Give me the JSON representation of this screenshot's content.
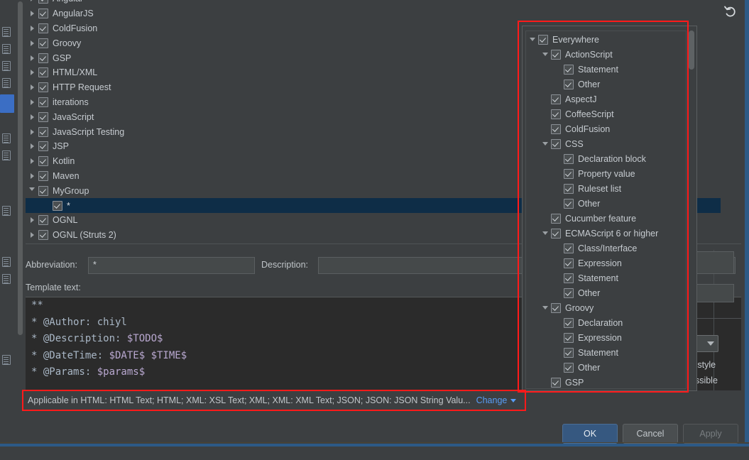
{
  "window": {
    "undo_icon": "undo-arrow-icon"
  },
  "gutter": {
    "icons": [
      "file-icon",
      "file-icon",
      "file-icon",
      "file-icon",
      "file-icon",
      "file-icon",
      "file-icon",
      "file-icon",
      "file-icon",
      "file-icon"
    ]
  },
  "template_tree": {
    "rows": [
      {
        "label": "Angular",
        "indent": 0,
        "expandable": true,
        "expanded": false,
        "checked": true,
        "selected": false,
        "clipped": true
      },
      {
        "label": "AngularJS",
        "indent": 0,
        "expandable": true,
        "expanded": false,
        "checked": true,
        "selected": false
      },
      {
        "label": "ColdFusion",
        "indent": 0,
        "expandable": true,
        "expanded": false,
        "checked": true,
        "selected": false
      },
      {
        "label": "Groovy",
        "indent": 0,
        "expandable": true,
        "expanded": false,
        "checked": true,
        "selected": false
      },
      {
        "label": "GSP",
        "indent": 0,
        "expandable": true,
        "expanded": false,
        "checked": true,
        "selected": false
      },
      {
        "label": "HTML/XML",
        "indent": 0,
        "expandable": true,
        "expanded": false,
        "checked": true,
        "selected": false
      },
      {
        "label": "HTTP Request",
        "indent": 0,
        "expandable": true,
        "expanded": false,
        "checked": true,
        "selected": false
      },
      {
        "label": "iterations",
        "indent": 0,
        "expandable": true,
        "expanded": false,
        "checked": true,
        "selected": false
      },
      {
        "label": "JavaScript",
        "indent": 0,
        "expandable": true,
        "expanded": false,
        "checked": true,
        "selected": false
      },
      {
        "label": "JavaScript Testing",
        "indent": 0,
        "expandable": true,
        "expanded": false,
        "checked": true,
        "selected": false
      },
      {
        "label": "JSP",
        "indent": 0,
        "expandable": true,
        "expanded": false,
        "checked": true,
        "selected": false
      },
      {
        "label": "Kotlin",
        "indent": 0,
        "expandable": true,
        "expanded": false,
        "checked": true,
        "selected": false
      },
      {
        "label": "Maven",
        "indent": 0,
        "expandable": true,
        "expanded": false,
        "checked": true,
        "selected": false
      },
      {
        "label": "MyGroup",
        "indent": 0,
        "expandable": true,
        "expanded": true,
        "checked": true,
        "selected": false
      },
      {
        "label": "*",
        "indent": 1,
        "expandable": false,
        "expanded": false,
        "checked": true,
        "selected": true
      },
      {
        "label": "OGNL",
        "indent": 0,
        "expandable": true,
        "expanded": false,
        "checked": true,
        "selected": false
      },
      {
        "label": "OGNL (Struts 2)",
        "indent": 0,
        "expandable": true,
        "expanded": false,
        "checked": true,
        "selected": false
      }
    ]
  },
  "fields": {
    "abbreviation_label": "Abbreviation:",
    "abbreviation_value": "*",
    "description_label": "Description:",
    "description_value": ""
  },
  "template_text": {
    "label": "Template text:",
    "lines": [
      [
        {
          "t": "**",
          "c": "plain"
        }
      ],
      [
        {
          "t": "* @Author: chiyl",
          "c": "plain"
        }
      ],
      [
        {
          "t": "* @Description: ",
          "c": "plain"
        },
        {
          "t": "$TODO$",
          "c": "tk"
        }
      ],
      [
        {
          "t": "* @DateTime: ",
          "c": "plain"
        },
        {
          "t": "$DATE$ $TIME$",
          "c": "tk"
        }
      ],
      [
        {
          "t": "* @Params: ",
          "c": "plain"
        },
        {
          "t": "$params$",
          "c": "tk"
        }
      ]
    ]
  },
  "status": {
    "text": "Applicable in HTML: HTML Text; HTML; XML: XSL Text; XML; XML: XML Text; JSON; JSON: JSON String Valu...",
    "change_label": "Change",
    "chevron_icon": "chevron-down-icon"
  },
  "footer": {
    "ok_label": "OK",
    "cancel_label": "Cancel",
    "apply_label": "Apply"
  },
  "right_panel": {
    "combo_value": ")",
    "combo_icon": "chevron-down-icon",
    "line1": "o style",
    "line2": "ossible"
  },
  "popup": {
    "rows": [
      {
        "label": "Everywhere",
        "indent": 0,
        "expandable": true,
        "checked": true
      },
      {
        "label": "ActionScript",
        "indent": 1,
        "expandable": true,
        "checked": true
      },
      {
        "label": "Statement",
        "indent": 2,
        "expandable": false,
        "checked": true
      },
      {
        "label": "Other",
        "indent": 2,
        "expandable": false,
        "checked": true
      },
      {
        "label": "AspectJ",
        "indent": 1,
        "expandable": false,
        "checked": true
      },
      {
        "label": "CoffeeScript",
        "indent": 1,
        "expandable": false,
        "checked": true
      },
      {
        "label": "ColdFusion",
        "indent": 1,
        "expandable": false,
        "checked": true
      },
      {
        "label": "CSS",
        "indent": 1,
        "expandable": true,
        "checked": true
      },
      {
        "label": "Declaration block",
        "indent": 2,
        "expandable": false,
        "checked": true
      },
      {
        "label": "Property value",
        "indent": 2,
        "expandable": false,
        "checked": true
      },
      {
        "label": "Ruleset list",
        "indent": 2,
        "expandable": false,
        "checked": true
      },
      {
        "label": "Other",
        "indent": 2,
        "expandable": false,
        "checked": true
      },
      {
        "label": "Cucumber feature",
        "indent": 1,
        "expandable": false,
        "checked": true
      },
      {
        "label": "ECMAScript 6 or higher",
        "indent": 1,
        "expandable": true,
        "checked": true
      },
      {
        "label": "Class/Interface",
        "indent": 2,
        "expandable": false,
        "checked": true
      },
      {
        "label": "Expression",
        "indent": 2,
        "expandable": false,
        "checked": true
      },
      {
        "label": "Statement",
        "indent": 2,
        "expandable": false,
        "checked": true
      },
      {
        "label": "Other",
        "indent": 2,
        "expandable": false,
        "checked": true
      },
      {
        "label": "Groovy",
        "indent": 1,
        "expandable": true,
        "checked": true
      },
      {
        "label": "Declaration",
        "indent": 2,
        "expandable": false,
        "checked": true
      },
      {
        "label": "Expression",
        "indent": 2,
        "expandable": false,
        "checked": true
      },
      {
        "label": "Statement",
        "indent": 2,
        "expandable": false,
        "checked": true
      },
      {
        "label": "Other",
        "indent": 2,
        "expandable": false,
        "checked": true
      },
      {
        "label": "GSP",
        "indent": 1,
        "expandable": false,
        "checked": true
      }
    ]
  },
  "colors": {
    "background": "#3c3f41",
    "selection": "#0e2d47",
    "editor_background": "#2b2b2b",
    "accent_button": "#365880",
    "link": "#589df6",
    "annotation": "#ff1a1a",
    "token": "#b9a8d0"
  }
}
